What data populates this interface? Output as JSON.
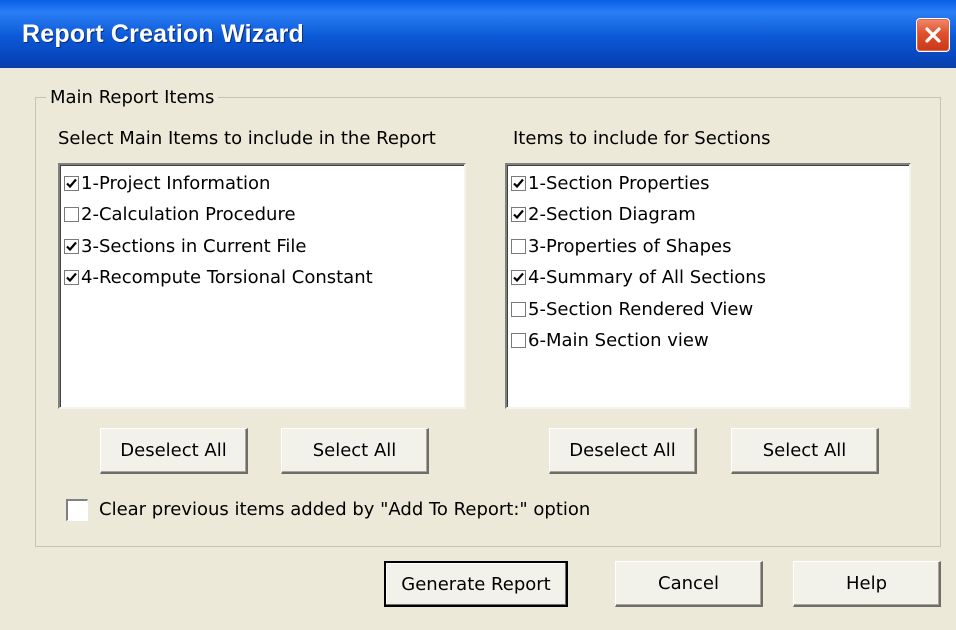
{
  "window": {
    "title": "Report Creation Wizard",
    "close_icon": "close-icon"
  },
  "group": {
    "legend": "Main Report Items"
  },
  "main_items": {
    "label": "Select Main Items to include in the Report",
    "items": [
      {
        "label": "1-Project Information",
        "checked": true
      },
      {
        "label": "2-Calculation Procedure",
        "checked": false
      },
      {
        "label": "3-Sections in Current File",
        "checked": true
      },
      {
        "label": "4-Recompute Torsional Constant",
        "checked": true
      }
    ],
    "deselect_label": "Deselect All",
    "select_label": "Select All"
  },
  "section_items": {
    "label": "Items to include for Sections",
    "items": [
      {
        "label": "1-Section Properties",
        "checked": true
      },
      {
        "label": "2-Section Diagram",
        "checked": true
      },
      {
        "label": "3-Properties of Shapes",
        "checked": false
      },
      {
        "label": "4-Summary of All Sections",
        "checked": true
      },
      {
        "label": "5-Section Rendered View",
        "checked": false
      },
      {
        "label": "6-Main Section view",
        "checked": false
      }
    ],
    "deselect_label": "Deselect All",
    "select_label": "Select All"
  },
  "clear_option": {
    "label": "Clear previous items added by \"Add To Report:\" option",
    "checked": false
  },
  "footer": {
    "generate_label": "Generate Report",
    "cancel_label": "Cancel",
    "help_label": "Help"
  }
}
